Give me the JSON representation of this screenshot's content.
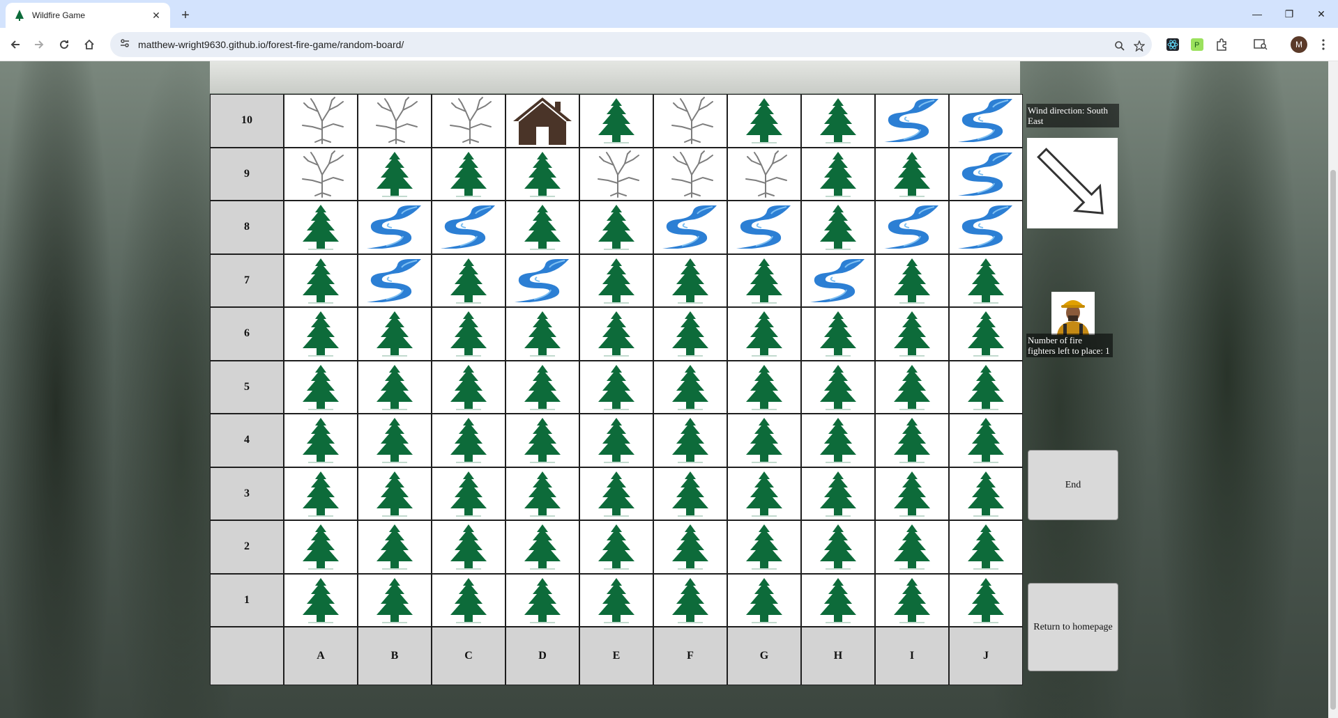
{
  "browser": {
    "tab_title": "Wildfire Game",
    "url": "matthew-wright9630.github.io/forest-fire-game/random-board/",
    "profile_initial": "M"
  },
  "board": {
    "rows": [
      {
        "label": "10",
        "cells": [
          "dead-tree",
          "dead-tree",
          "dead-tree",
          "house",
          "pine-tree",
          "dead-tree",
          "pine-tree",
          "pine-tree",
          "water",
          "water"
        ]
      },
      {
        "label": "9",
        "cells": [
          "dead-tree",
          "pine-tree",
          "pine-tree",
          "pine-tree",
          "dead-tree",
          "dead-tree",
          "dead-tree",
          "pine-tree",
          "pine-tree",
          "water"
        ]
      },
      {
        "label": "8",
        "cells": [
          "pine-tree",
          "water",
          "water",
          "pine-tree",
          "pine-tree",
          "water",
          "water",
          "pine-tree",
          "water",
          "water"
        ]
      },
      {
        "label": "7",
        "cells": [
          "pine-tree",
          "water",
          "pine-tree",
          "water",
          "pine-tree",
          "pine-tree",
          "pine-tree",
          "water",
          "pine-tree",
          "pine-tree"
        ]
      },
      {
        "label": "6",
        "cells": [
          "pine-tree",
          "pine-tree",
          "pine-tree",
          "pine-tree",
          "pine-tree",
          "pine-tree",
          "pine-tree",
          "pine-tree",
          "pine-tree",
          "pine-tree"
        ]
      },
      {
        "label": "5",
        "cells": [
          "pine-tree",
          "pine-tree",
          "pine-tree",
          "pine-tree",
          "pine-tree",
          "pine-tree",
          "pine-tree",
          "pine-tree",
          "pine-tree",
          "pine-tree"
        ]
      },
      {
        "label": "4",
        "cells": [
          "pine-tree",
          "pine-tree",
          "pine-tree",
          "pine-tree",
          "pine-tree",
          "pine-tree",
          "pine-tree",
          "pine-tree",
          "pine-tree",
          "pine-tree"
        ]
      },
      {
        "label": "3",
        "cells": [
          "pine-tree",
          "pine-tree",
          "pine-tree",
          "pine-tree",
          "pine-tree",
          "pine-tree",
          "pine-tree",
          "pine-tree",
          "pine-tree",
          "pine-tree"
        ]
      },
      {
        "label": "2",
        "cells": [
          "pine-tree",
          "pine-tree",
          "pine-tree",
          "pine-tree",
          "pine-tree",
          "pine-tree",
          "pine-tree",
          "pine-tree",
          "pine-tree",
          "pine-tree"
        ]
      },
      {
        "label": "1",
        "cells": [
          "pine-tree",
          "pine-tree",
          "pine-tree",
          "pine-tree",
          "pine-tree",
          "pine-tree",
          "pine-tree",
          "pine-tree",
          "pine-tree",
          "pine-tree"
        ]
      }
    ],
    "columns": [
      "A",
      "B",
      "C",
      "D",
      "E",
      "F",
      "G",
      "H",
      "I",
      "J"
    ]
  },
  "side": {
    "wind_label": "Wind direction: South East",
    "wind_icon": "arrow-south-east-icon",
    "firefighter_icon": "firefighter-icon",
    "firefighters_label": "Number of fire fighters left to place: 1",
    "end_button": "End",
    "home_button": "Return to homepage"
  },
  "colors": {
    "tree": "#0d6b3a",
    "water": "#2c7fd4",
    "house": "#4a3428",
    "dead_tree": "#8a8a8a",
    "label_bg": "#d3d3d3"
  }
}
